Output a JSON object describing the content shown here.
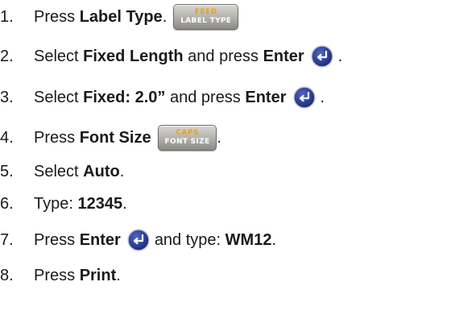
{
  "steps": [
    {
      "number": "1.",
      "pre": "Press ",
      "bold": "Label Type",
      "post": ".",
      "key": {
        "top": "FEED",
        "bottom": "LABEL TYPE",
        "icon": "label-type-key-icon"
      }
    },
    {
      "number": "2.",
      "pre": "Select ",
      "bold": "Fixed Length",
      "mid": " and press ",
      "bold2": "Enter",
      "post": ".",
      "icon": "enter-icon"
    },
    {
      "number": "3.",
      "pre": "Select ",
      "bold": "Fixed: 2.0”",
      "mid": " and press ",
      "bold2": "Enter",
      "post": ".",
      "icon": "enter-icon"
    },
    {
      "number": "4.",
      "pre": "Press ",
      "bold": "Font Size",
      "post": ".",
      "key": {
        "top": "CAPS",
        "bottom": "FONT SIZE",
        "icon": "font-size-key-icon"
      }
    },
    {
      "number": "5.",
      "pre": "Select ",
      "bold": "Auto",
      "post": "."
    },
    {
      "number": "6.",
      "pre": "Type: ",
      "bold": "12345",
      "post": "."
    },
    {
      "number": "7.",
      "pre": "Press ",
      "bold": "Enter",
      "mid": " and type: ",
      "bold2": "WM12",
      "post": ".",
      "icon": "enter-icon"
    },
    {
      "number": "8.",
      "pre": "Press ",
      "bold": "Print",
      "post": "."
    }
  ],
  "colors": {
    "text": "#1a1a1a",
    "keycap_top": "#e8a022",
    "keycap_bottom": "#ffffff",
    "enter_fill": "#2a3f9a"
  }
}
